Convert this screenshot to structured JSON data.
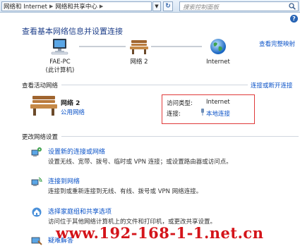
{
  "address_bar": {
    "crumbs": [
      "网络和 Internet",
      "网络和共享中心"
    ],
    "search_placeholder": "搜索控制面板"
  },
  "page": {
    "title": "查看基本网络信息并设置连接",
    "full_map_link": "查看完整映射"
  },
  "map": {
    "computer_name": "FAE-PC",
    "computer_sub": "(此计算机)",
    "network_label": "网络 2",
    "internet_label": "Internet"
  },
  "active": {
    "section_title": "查看活动网络",
    "connect_link": "连接或断开连接",
    "network_name": "网络 2",
    "network_type": "公用网络",
    "access_type_label": "访问类型:",
    "access_type_value": "Internet",
    "connection_label": "连接:",
    "connection_value": "本地连接"
  },
  "settings": {
    "section_title": "更改网络设置",
    "tasks": [
      {
        "title": "设置新的连接或网络",
        "desc": "设置无线、宽带、拨号、临时或 VPN 连接；或设置路由器或访问点。"
      },
      {
        "title": "连接到网络",
        "desc": "连接到或重新连接到无线、有线、拨号或 VPN 网络连接。"
      },
      {
        "title": "选择家庭组和共享选项",
        "desc": "访问位于其他网络计算机上的文件和打印机，或更改共享设置。"
      },
      {
        "title": "疑难解答",
        "desc": ""
      }
    ]
  },
  "watermark": "www.192-168-1-1.net.cn",
  "colors": {
    "link": "#0b53c8",
    "title": "#1e3f8a",
    "highlight_box": "#e03a3a",
    "watermark": "#d4141a"
  }
}
